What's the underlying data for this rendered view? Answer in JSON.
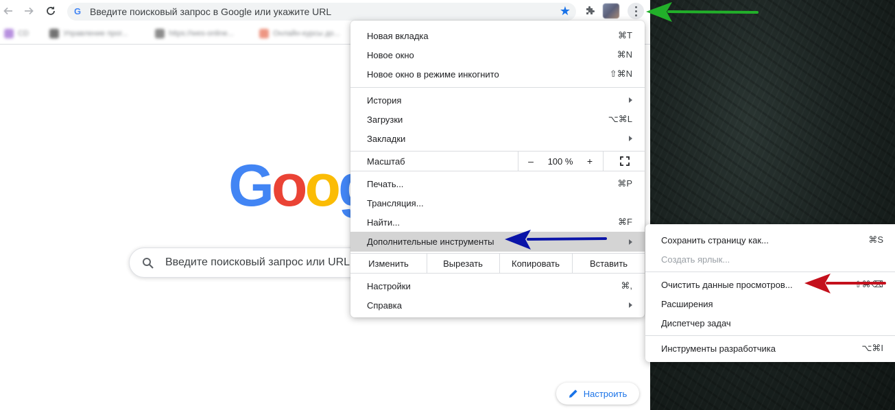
{
  "toolbar": {
    "omnibox_text": "Введите поисковый запрос в Google или укажите URL",
    "omnibox_icon": "G"
  },
  "bookmarks": [
    {
      "label": "CD"
    },
    {
      "label": "Управление прог..."
    },
    {
      "label": "https://wes-online..."
    },
    {
      "label": "Онлайн-курсы до..."
    }
  ],
  "page": {
    "logo": [
      "G",
      "o",
      "o",
      "g"
    ],
    "logo_colors": [
      "#4285f4",
      "#ea4335",
      "#fbbc05",
      "#4285f4"
    ],
    "search_placeholder": "Введите поисковый запрос или URL",
    "customize_label": "Настроить"
  },
  "menu": {
    "new_tab": {
      "label": "Новая вкладка",
      "shortcut": "⌘T"
    },
    "new_window": {
      "label": "Новое окно",
      "shortcut": "⌘N"
    },
    "incognito": {
      "label": "Новое окно в режиме инкогнито",
      "shortcut": "⇧⌘N"
    },
    "history": {
      "label": "История"
    },
    "downloads": {
      "label": "Загрузки",
      "shortcut": "⌥⌘L"
    },
    "bookmarks": {
      "label": "Закладки"
    },
    "zoom": {
      "label": "Масштаб",
      "minus": "–",
      "value": "100 %",
      "plus": "+"
    },
    "print": {
      "label": "Печать...",
      "shortcut": "⌘P"
    },
    "cast": {
      "label": "Трансляция..."
    },
    "find": {
      "label": "Найти...",
      "shortcut": "⌘F"
    },
    "more_tools": {
      "label": "Дополнительные инструменты"
    },
    "edit": {
      "label": "Изменить",
      "cut": "Вырезать",
      "copy": "Копировать",
      "paste": "Вставить"
    },
    "settings": {
      "label": "Настройки",
      "shortcut": "⌘,"
    },
    "help": {
      "label": "Справка"
    }
  },
  "submenu": {
    "save_page": {
      "label": "Сохранить страницу как...",
      "shortcut": "⌘S"
    },
    "create_shortcut": {
      "label": "Создать ярлык..."
    },
    "clear_data": {
      "label": "Очистить данные просмотров...",
      "shortcut": "⇧⌘⌫"
    },
    "extensions": {
      "label": "Расширения"
    },
    "task_manager": {
      "label": "Диспетчер задач"
    },
    "dev_tools": {
      "label": "Инструменты разработчика",
      "shortcut": "⌥⌘I"
    }
  },
  "annotation_colors": {
    "green": "#22b02a",
    "blue": "#0a14a8",
    "red": "#c4101c"
  }
}
